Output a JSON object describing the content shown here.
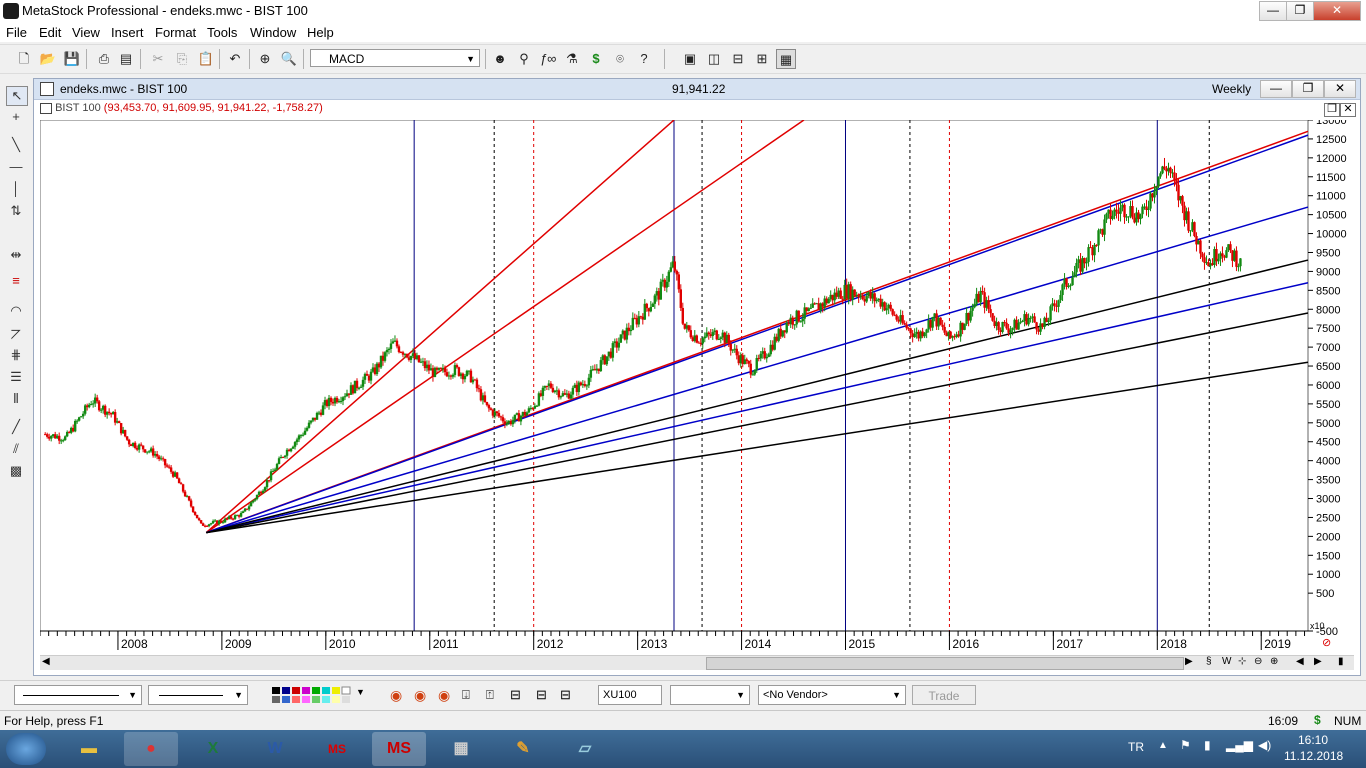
{
  "app": {
    "title": "MetaStock Professional - endeks.mwc - BIST 100",
    "min_label": "—",
    "max_label": "❐",
    "close_label": "✕"
  },
  "menu": [
    "File",
    "Edit",
    "View",
    "Insert",
    "Format",
    "Tools",
    "Window",
    "Help"
  ],
  "toolbar": {
    "indicator_value": "MACD"
  },
  "chart_window": {
    "title": "endeks.mwc - BIST 100",
    "center_value": "91,941.22",
    "period": "Weekly",
    "legend_name": "BIST 100",
    "legend_values": "(93,453.70, 91,609.95, 91,941.22, -1,758.27)",
    "scale_note": "x10"
  },
  "chart_data": {
    "type": "candlestick",
    "title": "BIST 100",
    "ylim": [
      -500,
      13000
    ],
    "y_ticks": [
      "13000",
      "12500",
      "12000",
      "11500",
      "11000",
      "10500",
      "10000",
      "9500",
      "9000",
      "8500",
      "8000",
      "7500",
      "7000",
      "6500",
      "6000",
      "5500",
      "5000",
      "4500",
      "4000",
      "3500",
      "3000",
      "2500",
      "2000",
      "1500",
      "1000",
      "500",
      "-500"
    ],
    "x_ticks": [
      "2008",
      "2009",
      "2010",
      "2011",
      "2012",
      "2013",
      "2014",
      "2015",
      "2016",
      "2017",
      "2018",
      "2019"
    ],
    "x_range": [
      2007.25,
      2019.45
    ],
    "price_path": [
      [
        2007.3,
        4700
      ],
      [
        2007.5,
        4600
      ],
      [
        2007.75,
        5600
      ],
      [
        2007.95,
        5200
      ],
      [
        2008.1,
        4500
      ],
      [
        2008.35,
        4200
      ],
      [
        2008.55,
        3600
      ],
      [
        2008.8,
        2300
      ],
      [
        2009.0,
        2400
      ],
      [
        2009.2,
        2600
      ],
      [
        2009.4,
        3300
      ],
      [
        2009.6,
        4200
      ],
      [
        2009.8,
        4800
      ],
      [
        2010.0,
        5500
      ],
      [
        2010.2,
        5800
      ],
      [
        2010.45,
        6300
      ],
      [
        2010.65,
        7100
      ],
      [
        2010.85,
        6700
      ],
      [
        2011.05,
        6300
      ],
      [
        2011.25,
        6400
      ],
      [
        2011.4,
        6200
      ],
      [
        2011.55,
        5400
      ],
      [
        2011.75,
        5000
      ],
      [
        2011.95,
        5300
      ],
      [
        2012.15,
        6000
      ],
      [
        2012.3,
        5700
      ],
      [
        2012.5,
        6100
      ],
      [
        2012.75,
        6900
      ],
      [
        2012.95,
        7600
      ],
      [
        2013.2,
        8400
      ],
      [
        2013.35,
        9200
      ],
      [
        2013.45,
        7500
      ],
      [
        2013.6,
        7200
      ],
      [
        2013.8,
        7400
      ],
      [
        2013.95,
        6800
      ],
      [
        2014.1,
        6400
      ],
      [
        2014.25,
        6900
      ],
      [
        2014.45,
        7700
      ],
      [
        2014.65,
        7900
      ],
      [
        2014.85,
        8300
      ],
      [
        2015.0,
        8500
      ],
      [
        2015.15,
        8400
      ],
      [
        2015.35,
        8200
      ],
      [
        2015.55,
        7600
      ],
      [
        2015.7,
        7300
      ],
      [
        2015.85,
        7800
      ],
      [
        2016.0,
        7200
      ],
      [
        2016.1,
        7500
      ],
      [
        2016.3,
        8400
      ],
      [
        2016.45,
        7600
      ],
      [
        2016.6,
        7500
      ],
      [
        2016.75,
        7800
      ],
      [
        2016.9,
        7500
      ],
      [
        2017.1,
        8600
      ],
      [
        2017.3,
        9300
      ],
      [
        2017.55,
        10500
      ],
      [
        2017.7,
        10700
      ],
      [
        2017.85,
        10400
      ],
      [
        2018.0,
        11500
      ],
      [
        2018.1,
        11800
      ],
      [
        2018.2,
        11000
      ],
      [
        2018.35,
        10000
      ],
      [
        2018.5,
        9200
      ],
      [
        2018.6,
        9600
      ],
      [
        2018.75,
        9400
      ],
      [
        2018.8,
        9190
      ]
    ],
    "fan_origin": [
      2008.85,
      2100
    ],
    "fan_lines": [
      {
        "color": "#e00000",
        "to": [
          2013.35,
          13000
        ]
      },
      {
        "color": "#e00000",
        "to": [
          2014.6,
          13000
        ]
      },
      {
        "color": "#e00000",
        "to": [
          2019.45,
          12700
        ]
      },
      {
        "color": "#0000c8",
        "to": [
          2019.45,
          12600
        ]
      },
      {
        "color": "#0000c8",
        "to": [
          2019.45,
          10700
        ]
      },
      {
        "color": "#0000c8",
        "to": [
          2019.45,
          8700
        ]
      },
      {
        "color": "#000000",
        "to": [
          2019.45,
          9300
        ]
      },
      {
        "color": "#000000",
        "to": [
          2019.45,
          7900
        ]
      },
      {
        "color": "#000000",
        "to": [
          2019.45,
          6600
        ]
      }
    ],
    "vlines": [
      {
        "x": 2010.85,
        "color": "#000080",
        "dash": false
      },
      {
        "x": 2011.62,
        "color": "#000000",
        "dash": true
      },
      {
        "x": 2012.0,
        "color": "#e00000",
        "dash": true
      },
      {
        "x": 2013.35,
        "color": "#000080",
        "dash": false
      },
      {
        "x": 2013.62,
        "color": "#000000",
        "dash": true
      },
      {
        "x": 2014.0,
        "color": "#e00000",
        "dash": true
      },
      {
        "x": 2015.0,
        "color": "#000080",
        "dash": false
      },
      {
        "x": 2015.62,
        "color": "#000000",
        "dash": true
      },
      {
        "x": 2016.0,
        "color": "#e00000",
        "dash": true
      },
      {
        "x": 2018.0,
        "color": "#000080",
        "dash": false
      },
      {
        "x": 2018.5,
        "color": "#000000",
        "dash": true
      }
    ]
  },
  "bottom": {
    "symbol": "XU100",
    "vendor": "<No Vendor>",
    "trade": "Trade"
  },
  "status": {
    "help": "For Help, press F1",
    "time": "16:09",
    "currency": "$",
    "num": "NUM"
  },
  "taskbar": {
    "lang": "TR",
    "clock_time": "16:10",
    "clock_date": "11.12.2018",
    "apps": [
      "folder-icon",
      "chrome-icon",
      "excel-icon",
      "word-icon",
      "metastock-downloader-icon",
      "metastock-icon",
      "calculator-icon",
      "paint-icon",
      "notepad-icon"
    ]
  }
}
